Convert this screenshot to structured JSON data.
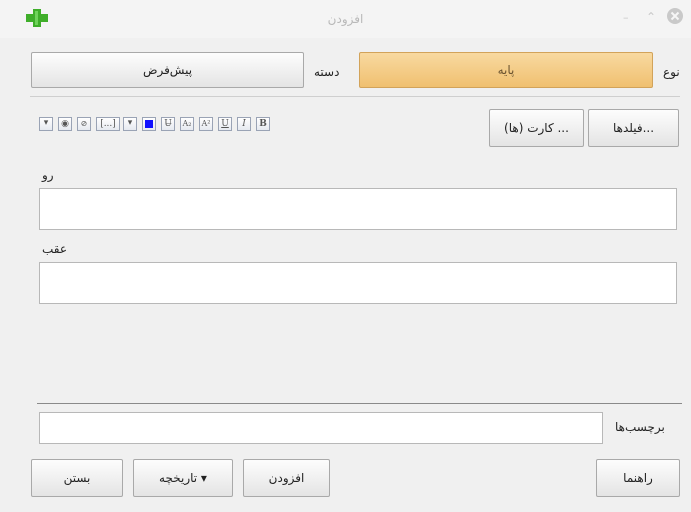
{
  "window": {
    "title": "افزودن"
  },
  "type_row": {
    "type_label": "نوع",
    "type_value": "پایه",
    "deck_label": "دسته",
    "deck_value": "پیش‌فرض"
  },
  "toolbar": {
    "fields_button": "فیلدها...",
    "cards_button": "کارت (ها) ...",
    "bold": "B",
    "italic": "I",
    "underline": "U",
    "superscript": "A²",
    "subscript": "A₂",
    "clear_format": "U̶",
    "text_color_value": "#1010ff",
    "cloze": "[...]",
    "attach": "📎",
    "record": "◉",
    "more": "▾",
    "color_arrow": "▾"
  },
  "fields": [
    {
      "label": "رو",
      "value": ""
    },
    {
      "label": "عقب",
      "value": ""
    }
  ],
  "tags": {
    "label": "برچسب‌ها",
    "value": ""
  },
  "bottom": {
    "help": "راهنما",
    "add": "افزودن",
    "history": "تاریخچه ▾",
    "close": "بستن"
  }
}
